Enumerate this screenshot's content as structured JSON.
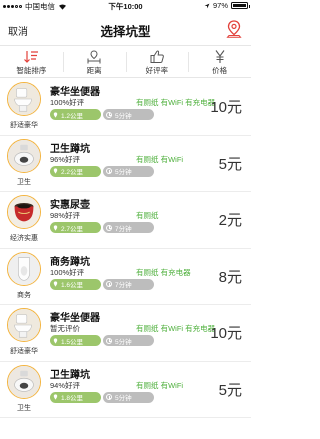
{
  "status_bar": {
    "carrier": "中国电信",
    "time": "下午10:00",
    "battery_text": "97%",
    "battery_level": 0.97
  },
  "nav": {
    "cancel_label": "取消",
    "title": "选择坑型",
    "location_icon": "location-pin-icon"
  },
  "sort_tabs": [
    {
      "label": "智能排序",
      "icon": "sort-icon"
    },
    {
      "label": "距离",
      "icon": "distance-icon"
    },
    {
      "label": "好评率",
      "icon": "thumbs-up-icon"
    },
    {
      "label": "价格",
      "icon": "yen-icon"
    }
  ],
  "accent": {
    "green": "#4caf3a",
    "pill_green": "#9cc66b",
    "pill_gray": "#bdbdbd",
    "thumb_border": "#f3b33d"
  },
  "listings": [
    {
      "title": "豪华坐便器",
      "rating": "100%好评",
      "amenities": "有厕纸 有WiFi 有充电器",
      "distance": "1.2公里",
      "time": "5分钟",
      "price": "10元",
      "category": "舒适豪华",
      "kind": "toilet"
    },
    {
      "title": "卫生蹲坑",
      "rating": "96%好评",
      "amenities": "有厕纸 有WiFi",
      "distance": "2.2公里",
      "time": "5分钟",
      "price": "5元",
      "category": "卫生",
      "kind": "squat"
    },
    {
      "title": "实惠尿壶",
      "rating": "98%好评",
      "amenities": "有厕纸",
      "distance": "2.7公里",
      "time": "7分钟",
      "price": "2元",
      "category": "经济实惠",
      "kind": "pot"
    },
    {
      "title": "商务蹲坑",
      "rating": "100%好评",
      "amenities": "有厕纸 有充电器",
      "distance": "1.6公里",
      "time": "7分钟",
      "price": "8元",
      "category": "商务",
      "kind": "urinal"
    },
    {
      "title": "豪华坐便器",
      "rating": "暂无评价",
      "amenities": "有厕纸 有WiFi 有充电器",
      "distance": "1.5公里",
      "time": "5分钟",
      "price": "10元",
      "category": "舒适豪华",
      "kind": "toilet"
    },
    {
      "title": "卫生蹲坑",
      "rating": "94%好评",
      "amenities": "有厕纸 有WiFi",
      "distance": "1.8公里",
      "time": "5分钟",
      "price": "5元",
      "category": "卫生",
      "kind": "squat"
    }
  ]
}
